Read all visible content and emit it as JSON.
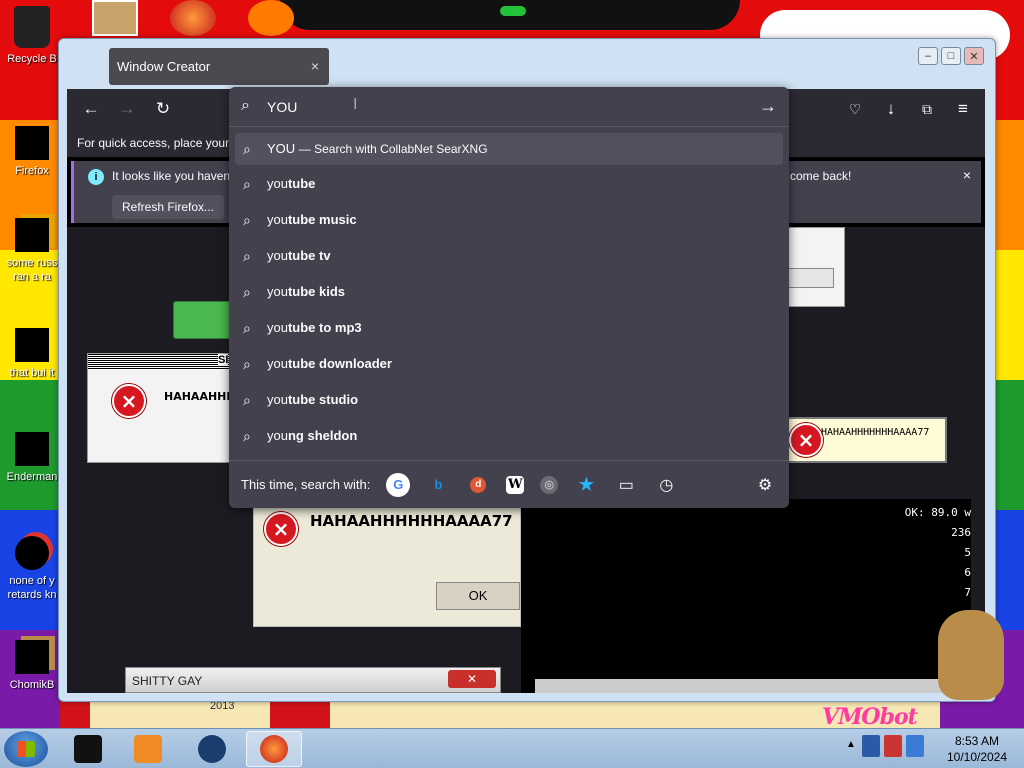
{
  "desktop": {
    "icons": [
      {
        "label": "Recycle B",
        "icon": "recycle-bin-icon"
      },
      {
        "label": "Firefox",
        "icon": "firefox-icon"
      },
      {
        "label": "some russ ran a ra",
        "icon": "file-icon"
      },
      {
        "label": "that bui it",
        "icon": "folder-icon"
      },
      {
        "label": "Enderman",
        "icon": "app-icon"
      },
      {
        "label": "none of y retards kn",
        "icon": "chrome-icon"
      },
      {
        "label": "ChomikB",
        "icon": "hamster-icon"
      }
    ],
    "wallpaper_year": "2013",
    "wallpaper_text": "VMObot"
  },
  "window": {
    "tab_title": "Window Creator",
    "tab_close": "×",
    "controls": {
      "minimize": "–",
      "maximize": "□",
      "close": "✕"
    }
  },
  "firefox": {
    "toolbar": {
      "back": "←",
      "forward": "→",
      "reload": "↻",
      "pocket": "pocket-icon",
      "downloads": "↓",
      "extensions": "extensions-icon",
      "menu": "≡"
    },
    "bookmarks_hint": "For quick access, place your b",
    "notice": {
      "message_start": "It looks like you haven",
      "message_end": "come back!",
      "refresh_button": "Refresh Firefox...",
      "close": "×"
    },
    "urlbar": {
      "typed_text": "YOU",
      "suggestions": [
        {
          "prefix": "YOU",
          "bold": "",
          "suffix": "— Search with CollabNet SearXNG"
        },
        {
          "prefix": "you",
          "bold": "tube"
        },
        {
          "prefix": "you",
          "bold": "tube music"
        },
        {
          "prefix": "you",
          "bold": "tube tv"
        },
        {
          "prefix": "you",
          "bold": "tube kids"
        },
        {
          "prefix": "you",
          "bold": "tube to mp3"
        },
        {
          "prefix": "you",
          "bold": "tube downloader"
        },
        {
          "prefix": "you",
          "bold": "tube studio"
        },
        {
          "prefix": "you",
          "bold": "ng sheldon"
        }
      ],
      "one_offs_label": "This time, search with:",
      "engines": [
        {
          "name": "google",
          "glyph": "G",
          "color": "#4285f4",
          "bg": "#ffffff"
        },
        {
          "name": "bing",
          "glyph": "b",
          "color": "#1d8fe0",
          "bg": "transparent"
        },
        {
          "name": "duckduckgo",
          "glyph": "d",
          "color": "#ffffff",
          "bg": "#de5833"
        },
        {
          "name": "wikipedia",
          "glyph": "W",
          "color": "#000000",
          "bg": "#ffffff"
        },
        {
          "name": "searx",
          "glyph": "◎",
          "color": "#9a9a9a",
          "bg": "#6a6a72"
        },
        {
          "name": "bookmarks",
          "glyph": "★",
          "color": "#27b5ff",
          "bg": "transparent"
        },
        {
          "name": "tabs",
          "glyph": "▭",
          "color": "#fbfbfe",
          "bg": "transparent"
        },
        {
          "name": "history",
          "glyph": "◷",
          "color": "#fbfbfe",
          "bg": "transparent"
        }
      ],
      "settings": "⚙"
    }
  },
  "background_dialogs": {
    "dialog1_title": "SI",
    "dialog1_text": "HAHAAHHH",
    "dialog2_text": "HAHAAHHHHHHHAAAA77",
    "dialog3_text": "HAHAAHHHHHHAAAA77",
    "ok_label": "OK",
    "terminal_lines": [
      "OK: 89.0 w",
      "236",
      "5",
      "6",
      "7"
    ],
    "shitty_title": "SHITTY GAY"
  },
  "taskbar": {
    "start": "start-button",
    "clock_time": "8:53 AM",
    "clock_date": "10/10/2024",
    "tray_arrow": "▲"
  }
}
